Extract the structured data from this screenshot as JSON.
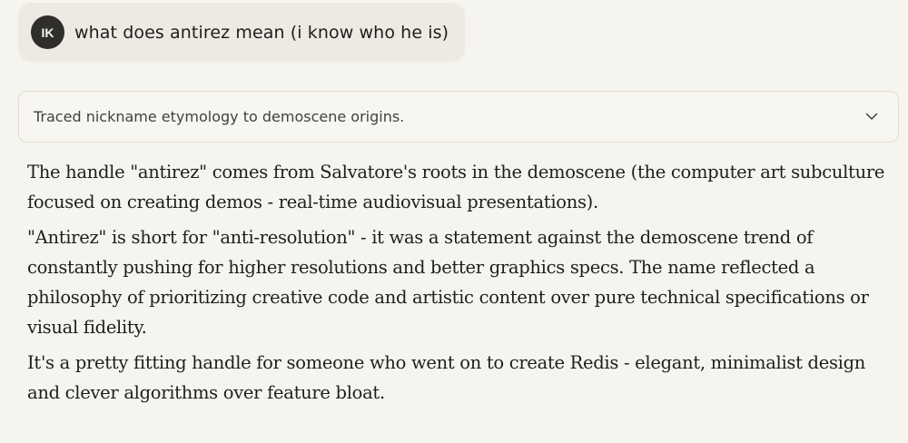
{
  "user_message": {
    "avatar_initials": "IK",
    "text": "what does antirez mean (i know who he is)"
  },
  "thinking_summary": {
    "label": "Traced nickname etymology to demoscene origins.",
    "toggle_icon": "chevron-down-icon"
  },
  "response": {
    "paragraphs": [
      "The handle \"antirez\" comes from Salvatore's roots in the demoscene (the computer art subculture focused on creating demos - real-time audiovisual presentations).",
      "\"Antirez\" is short for \"anti-resolution\" - it was a statement against the demoscene trend of constantly pushing for higher resolutions and better graphics specs. The name reflected a philosophy of prioritizing creative code and artistic content over pure technical specifications or visual fidelity.",
      "It's a pretty fitting handle for someone who went on to create Redis - elegant, minimalist design and clever algorithms over feature bloat."
    ]
  },
  "colors": {
    "background": "#f5f4ee",
    "user_bubble": "#eceae3",
    "avatar": "#2f2e2c",
    "text": "#1f1e1c"
  }
}
